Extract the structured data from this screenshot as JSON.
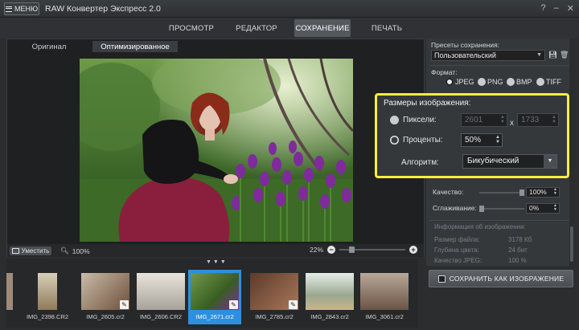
{
  "app": {
    "menu_label": "МЕНЮ",
    "title": "RAW Конвертер Экспресс 2.0"
  },
  "window_controls": [
    "?",
    "–",
    "✕"
  ],
  "nav": {
    "tabs": [
      {
        "label": "ПРОСМОТР",
        "active": false
      },
      {
        "label": "РЕДАКТОР",
        "active": false
      },
      {
        "label": "СОХРАНЕНИЕ",
        "active": true
      },
      {
        "label": "ПЕЧАТЬ",
        "active": false
      }
    ]
  },
  "viewer": {
    "tabs": [
      {
        "label": "Оригинал",
        "active": false
      },
      {
        "label": "Оптимизированное",
        "active": true
      }
    ],
    "fit_label": "Уместить",
    "left_zoom": "100%",
    "right_zoom": "22%",
    "zoom_level": 0.22
  },
  "filmstrip": {
    "arrows": "▼▼▼",
    "items": [
      {
        "caption": "IMG_2398.CR2",
        "edited": false,
        "active": false
      },
      {
        "caption": "IMG_2605.cr2",
        "edited": true,
        "active": false
      },
      {
        "caption": "IMG_2606.CR2",
        "edited": false,
        "active": false
      },
      {
        "caption": "IMG_2671.cr2",
        "edited": true,
        "active": true
      },
      {
        "caption": "IMG_2785.cr2",
        "edited": true,
        "active": false
      },
      {
        "caption": "IMG_2843.cr2",
        "edited": false,
        "active": false
      },
      {
        "caption": "IMG_3061.cr2",
        "edited": false,
        "active": false
      }
    ]
  },
  "panel": {
    "presets_label": "Пресеты сохранения:",
    "preset_value": "Пользовательский",
    "format_label": "Формат:",
    "formats": [
      {
        "label": "JPEG",
        "selected": true
      },
      {
        "label": "PNG",
        "selected": false
      },
      {
        "label": "BMP",
        "selected": false
      },
      {
        "label": "TIFF",
        "selected": false
      }
    ],
    "sizes": {
      "title": "Размеры изображения:",
      "pixels_label": "Пиксели:",
      "width": "2601",
      "x": "x",
      "height": "1733",
      "percent_label": "Проценты:",
      "percent_value": "50%",
      "algorithm_label": "Алгоритм:",
      "algorithm_value": "Бикубический"
    },
    "quality_label": "Качество:",
    "quality_value": "100%",
    "quality_level": 1.0,
    "smoothing_label": "Сглаживание:",
    "smoothing_value": "0%",
    "smoothing_level": 0.0,
    "info": {
      "title": "Информация об изображении:",
      "file_size_label": "Размер файла:",
      "file_size": "3178 Кб",
      "depth_label": "Глубина цвета:",
      "depth": "24 бит",
      "jpeg_q_label": "Качество JPEG:",
      "jpeg_q": "100 %"
    },
    "save_label": "СОХРАНИТЬ КАК ИЗОБРАЖЕНИЕ"
  },
  "colors": {
    "highlight": "#f6ef3a",
    "accent_active": "#2d8fe0"
  }
}
